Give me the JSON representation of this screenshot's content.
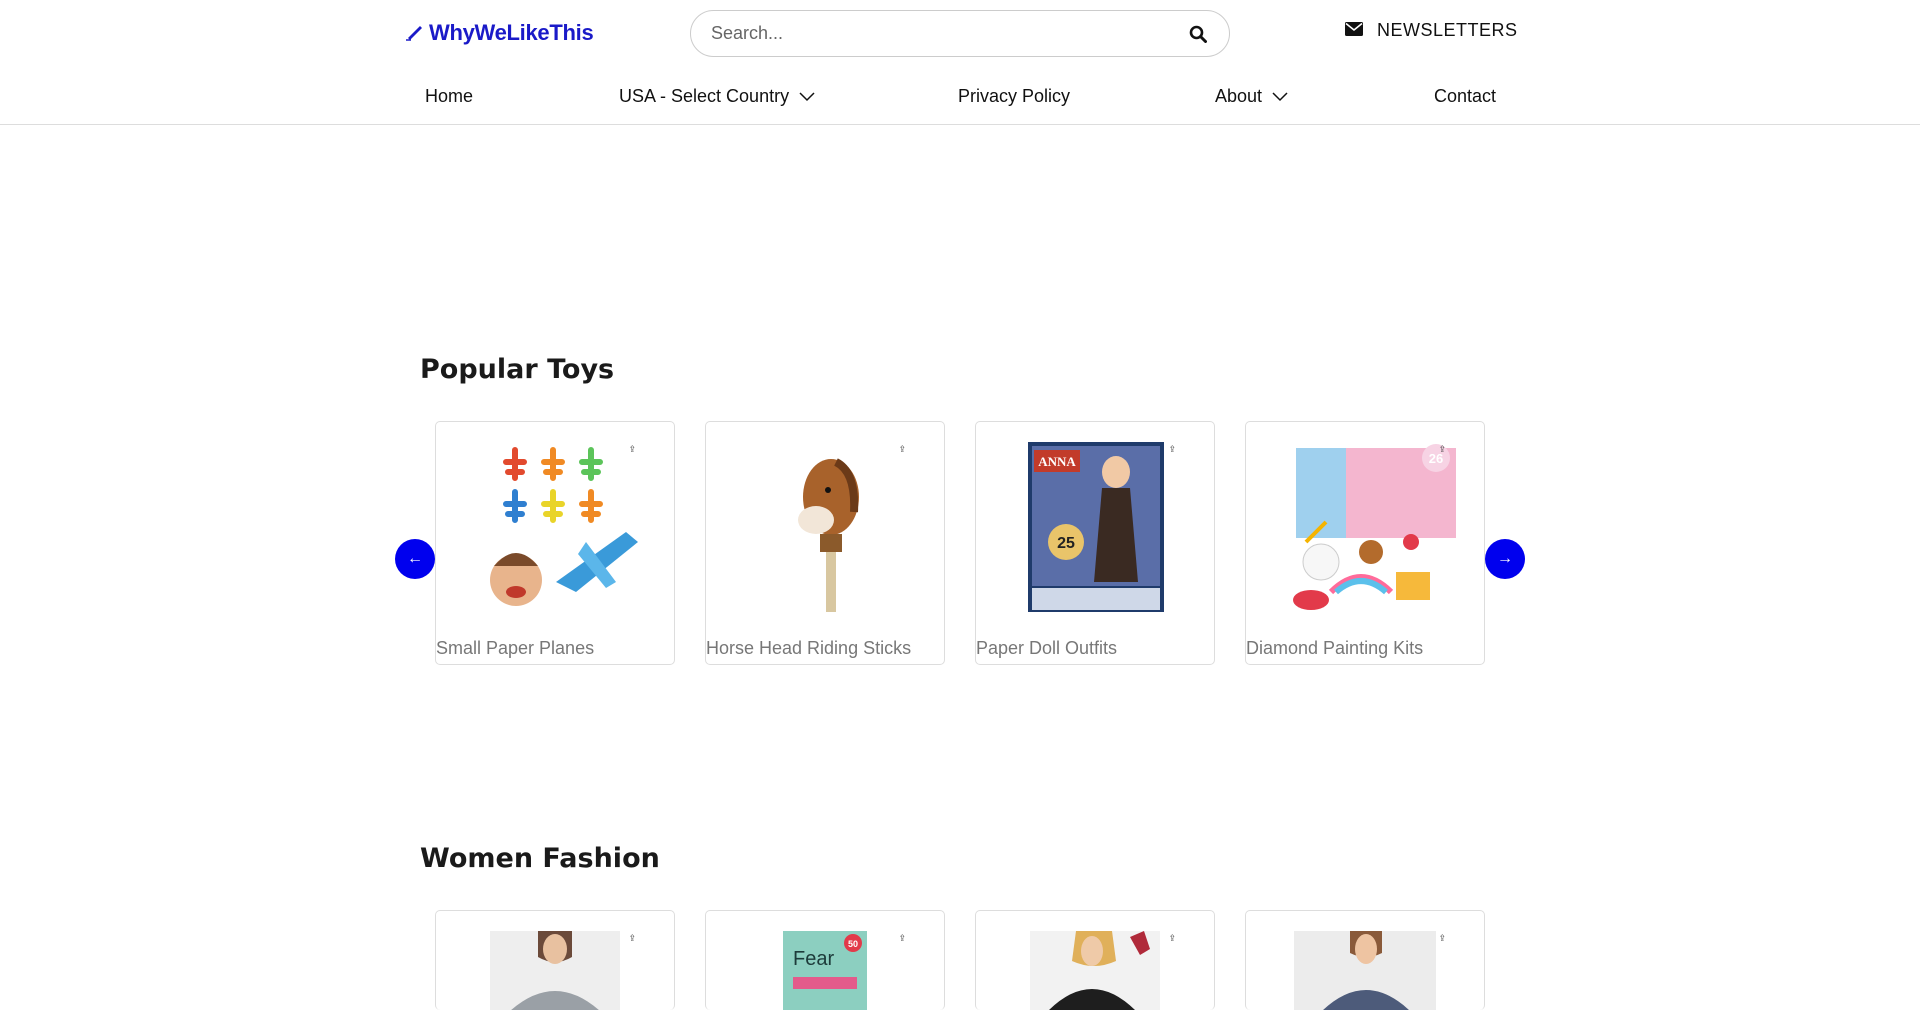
{
  "header": {
    "logo_text": "WhyWeLikeThis",
    "search_placeholder": "Search...",
    "newsletter_label": "NEWSLETTERS"
  },
  "nav": {
    "items": [
      {
        "label": "Home"
      },
      {
        "label": "USA - Select Country"
      },
      {
        "label": "Privacy Policy"
      },
      {
        "label": "About"
      },
      {
        "label": "Contact"
      }
    ]
  },
  "sections": [
    {
      "title": "Popular Toys",
      "cards": [
        {
          "label": "Small Paper Planes",
          "icon": "paper-planes-image"
        },
        {
          "label": "Horse Head Riding Sticks",
          "icon": "horse-stick-image"
        },
        {
          "label": "Paper Doll Outfits",
          "icon": "paper-doll-box-image"
        },
        {
          "label": "Diamond Painting Kits",
          "icon": "diamond-stickers-image"
        }
      ],
      "doll_box": {
        "name": "ANNA",
        "count": "25"
      },
      "sticker_badge": "26"
    },
    {
      "title": "Women Fashion",
      "pack_title": "Fear",
      "pack_count": "50"
    }
  ],
  "carousel": {
    "prev_symbol": "←",
    "next_symbol": "→"
  },
  "colors": {
    "brand": "#1a1ac8",
    "arrow_bg": "#0000ee"
  }
}
